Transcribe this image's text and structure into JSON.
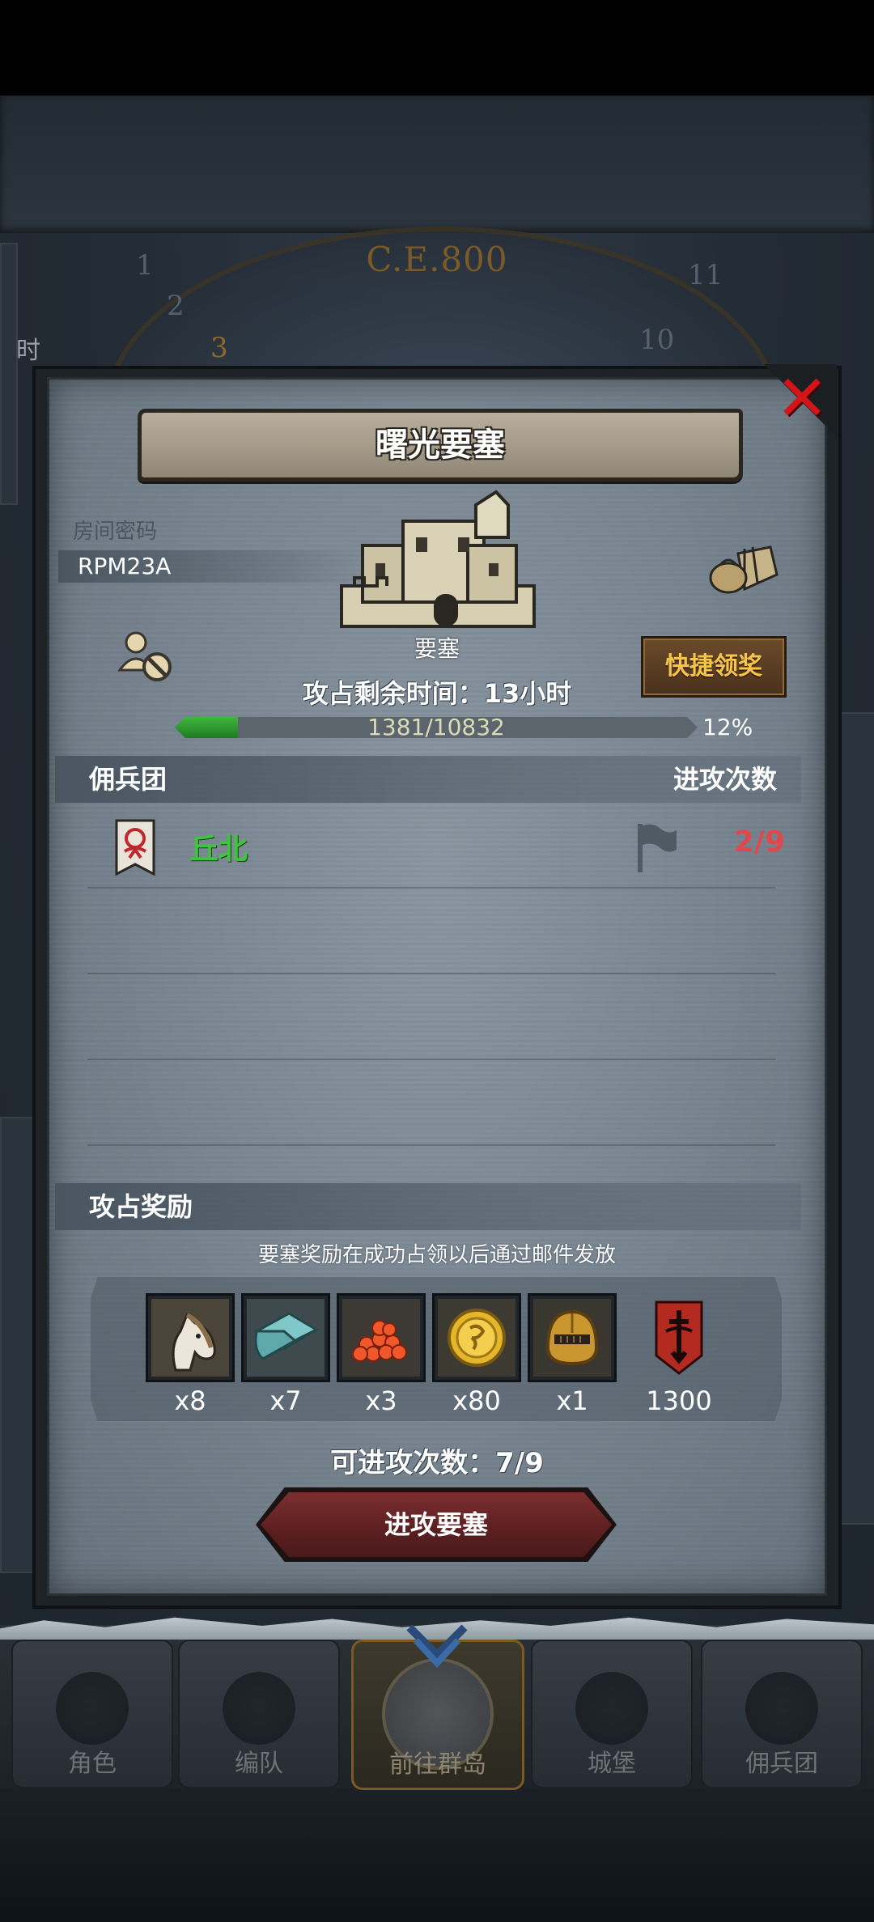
{
  "background": {
    "era": "C.E.800",
    "dial_numbers": [
      "1",
      "2",
      "3",
      "10",
      "11"
    ],
    "side_text": "时"
  },
  "modal": {
    "title": "曙光要塞",
    "close_icon": "close-icon",
    "room": {
      "label": "房间密码",
      "code": "RPM23A"
    },
    "fortress_label": "要塞",
    "quick_claim_label": "快捷领奖",
    "time_label": "攻占剩余时间：13小时",
    "progress": {
      "current": 1381,
      "total": 10832,
      "text": "1381/10832",
      "percent_text": "12%",
      "fraction": 0.12
    },
    "mercenary_section": {
      "left": "佣兵团",
      "right": "进攻次数"
    },
    "mercenaries": [
      {
        "name": "丘北",
        "attacks": "2/9",
        "name_color": "#3ec43e",
        "count_color": "#e0484e"
      }
    ],
    "reward_section": {
      "title": "攻占奖励"
    },
    "reward_note": "要塞奖励在成功占领以后通过邮件发放",
    "rewards": [
      {
        "icon": "horse-icon",
        "qty": "x8"
      },
      {
        "icon": "cloth-icon",
        "qty": "x7"
      },
      {
        "icon": "beads-icon",
        "qty": "x3"
      },
      {
        "icon": "gold-coin-icon",
        "qty": "x80"
      },
      {
        "icon": "helmet-icon",
        "qty": "x1"
      },
      {
        "icon": "sword-banner-icon",
        "qty": "1300"
      }
    ],
    "attempts_label": "可进攻次数：7/9",
    "attack_button": "进攻要塞"
  },
  "nav": {
    "items": [
      {
        "label": "角色",
        "icon": "knight-icon"
      },
      {
        "label": "编队",
        "icon": "formation-icon"
      },
      {
        "label": "前往群岛",
        "icon": "islands-icon",
        "active": true
      },
      {
        "label": "城堡",
        "icon": "castle-icon"
      },
      {
        "label": "佣兵团",
        "icon": "mercenary-icon"
      }
    ]
  },
  "colors": {
    "accent_gold": "#f6c44a",
    "progress_green": "#3ec43e",
    "danger_red": "#d3151a"
  }
}
